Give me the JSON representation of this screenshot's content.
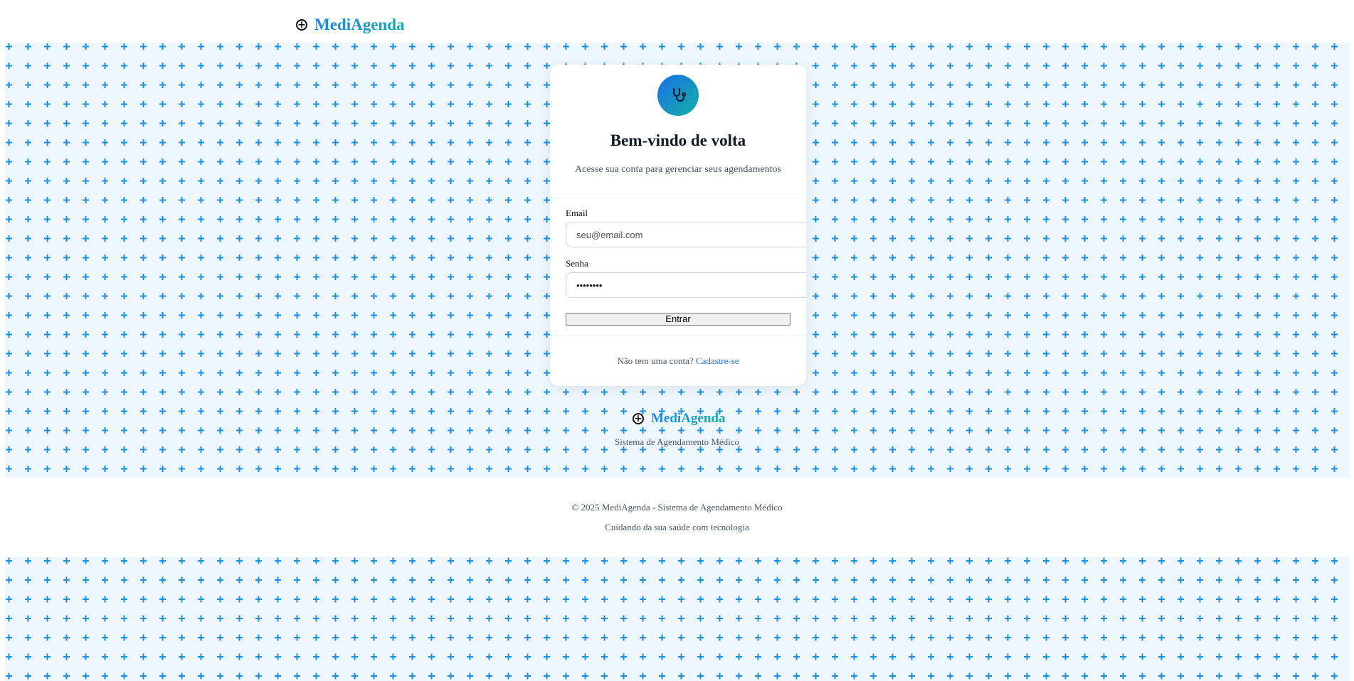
{
  "header": {
    "brand_name": "MediAgenda",
    "brand_icon": "plus-circle-icon"
  },
  "login": {
    "avatar_icon": "stethoscope-icon",
    "title": "Bem-vindo de volta",
    "subtitle": "Acesse sua conta para gerenciar seus agendamentos",
    "email_label": "Email",
    "email_placeholder": "seu@email.com",
    "email_value": "",
    "password_label": "Senha",
    "password_value": "••••••••",
    "submit_label": "Entrar",
    "signup_prompt": "Não tem uma conta?",
    "signup_link": "Cadastre-se"
  },
  "section_footer": {
    "brand_name": "MediAgenda",
    "brand_icon": "plus-circle-icon",
    "tagline": "Sistema de Agendamento Médico"
  },
  "page_footer": {
    "copyright": "© 2025 MediAgenda - Sistema de Agendamento Médico",
    "slogan": "Cuidando da sua saúde com tecnologia"
  },
  "colors": {
    "accent_blue": "#1a84e6",
    "accent_teal": "#14b0a4",
    "pattern_plus": "#1a8fe0",
    "pattern_bg": "#eef7fd",
    "link": "#1a73e8"
  }
}
